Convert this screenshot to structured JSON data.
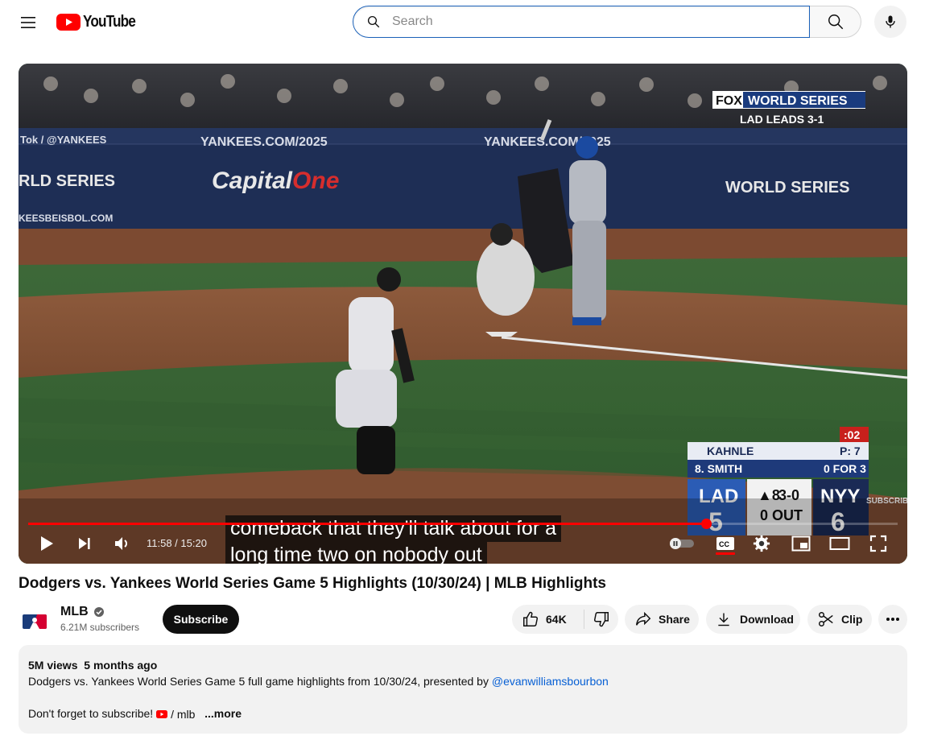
{
  "header": {
    "logo_text": "YouTube",
    "search_placeholder": "Search",
    "icons": [
      "menu-icon",
      "youtube-logo-icon",
      "search-icon",
      "mic-icon"
    ]
  },
  "player": {
    "overlay_network": "FOX",
    "overlay_event": "WORLD SERIES",
    "overlay_series_status": "LAD LEADS 3-1",
    "subtitle_line1": "comeback that they'll talk about for a",
    "subtitle_line2": "long time two on nobody out",
    "time_current": "11:58",
    "time_total": "15:20",
    "time_display": "11:58 / 15:20",
    "progress_fraction": 0.78,
    "scorebug": {
      "pitch_clock": ":02",
      "pitcher": "KAHNLE",
      "pitch_count": "P: 7",
      "batter": "8. SMITH",
      "batter_line": "0 FOR 3",
      "away_team": "LAD",
      "away_score": "5",
      "inning": "▲8",
      "count": "3-0",
      "outs": "0 OUT",
      "home_team": "NYY",
      "home_score": "6"
    },
    "watermark": "SUBSCRIBE",
    "stadium_signs": [
      "YANKEES.COM/2025",
      "YANKEES.COM/2025",
      "Tok / @YANKEES",
      "KEESBEISBOL.COM"
    ]
  },
  "video": {
    "title": "Dodgers vs. Yankees World Series Game 5 Highlights (10/30/24) | MLB Highlights"
  },
  "channel": {
    "name": "MLB",
    "subscribers": "6.21M subscribers",
    "subscribe_label": "Subscribe"
  },
  "actions": {
    "likes": "64K",
    "share_label": "Share",
    "download_label": "Download",
    "clip_label": "Clip"
  },
  "description": {
    "views": "5M views",
    "age": "5 months ago",
    "text": "Dodgers vs. Yankees World Series Game 5 full game highlights from 10/30/24, presented by ",
    "link": "@evanwilliamsbourbon",
    "cta": "Don't forget to subscribe! ",
    "channel_link": "/ mlb",
    "more_label": "...more"
  },
  "colors": {
    "accent": "#ff0000",
    "link": "#065fd4",
    "search_focus": "#1c62b9"
  }
}
